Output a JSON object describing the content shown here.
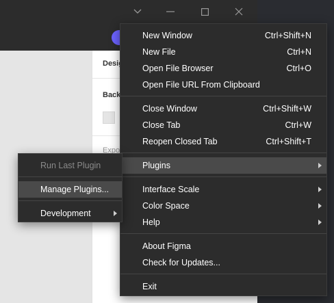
{
  "app": {
    "panel_tab": "Desig",
    "panel_background_label": "Back",
    "panel_export_label": "Expo"
  },
  "main_menu": {
    "items": [
      {
        "label": "New Window",
        "shortcut": "Ctrl+Shift+N"
      },
      {
        "label": "New File",
        "shortcut": "Ctrl+N"
      },
      {
        "label": "Open File Browser",
        "shortcut": "Ctrl+O"
      },
      {
        "label": "Open File URL From Clipboard",
        "shortcut": ""
      },
      {
        "label": "Close Window",
        "shortcut": "Ctrl+Shift+W"
      },
      {
        "label": "Close Tab",
        "shortcut": "Ctrl+W"
      },
      {
        "label": "Reopen Closed Tab",
        "shortcut": "Ctrl+Shift+T"
      },
      {
        "label": "Plugins",
        "shortcut": ""
      },
      {
        "label": "Interface Scale",
        "shortcut": ""
      },
      {
        "label": "Color Space",
        "shortcut": ""
      },
      {
        "label": "Help",
        "shortcut": ""
      },
      {
        "label": "About Figma",
        "shortcut": ""
      },
      {
        "label": "Check for Updates...",
        "shortcut": ""
      },
      {
        "label": "Exit",
        "shortcut": ""
      }
    ]
  },
  "plugins_submenu": {
    "items": [
      {
        "label": "Run Last Plugin"
      },
      {
        "label": "Manage Plugins..."
      },
      {
        "label": "Development"
      }
    ]
  },
  "icons": {
    "minimize": "minimize-icon",
    "maximize": "maximize-icon",
    "close": "close-icon",
    "dropdown": "chevron-down-icon"
  }
}
